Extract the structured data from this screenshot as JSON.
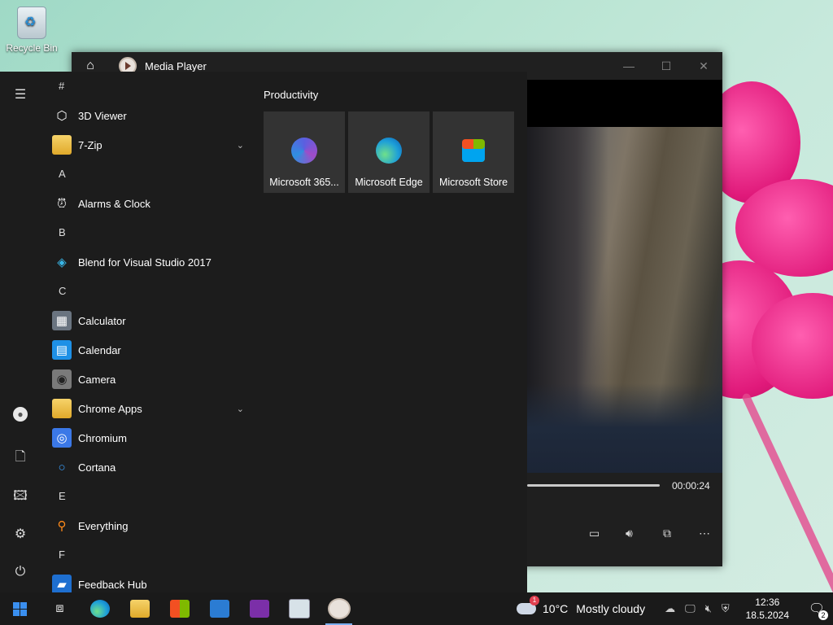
{
  "desktop": {
    "recycle_bin_label": "Recycle Bin"
  },
  "media_player": {
    "title": "Media Player",
    "time": "00:00:24",
    "progress": 1.0
  },
  "start": {
    "sections": [
      {
        "letter": "#",
        "items": [
          {
            "label": "3D Viewer",
            "icon": "cube-icon"
          },
          {
            "label": "7-Zip",
            "icon": "folder-icon",
            "expandable": true
          }
        ]
      },
      {
        "letter": "A",
        "items": [
          {
            "label": "Alarms & Clock",
            "icon": "clock-icon"
          }
        ]
      },
      {
        "letter": "B",
        "items": [
          {
            "label": "Blend for Visual Studio 2017",
            "icon": "blend-icon"
          }
        ]
      },
      {
        "letter": "C",
        "items": [
          {
            "label": "Calculator",
            "icon": "calculator-icon"
          },
          {
            "label": "Calendar",
            "icon": "calendar-icon"
          },
          {
            "label": "Camera",
            "icon": "camera-icon"
          },
          {
            "label": "Chrome Apps",
            "icon": "folder-icon",
            "expandable": true
          },
          {
            "label": "Chromium",
            "icon": "chromium-icon"
          },
          {
            "label": "Cortana",
            "icon": "cortana-icon"
          }
        ]
      },
      {
        "letter": "E",
        "items": [
          {
            "label": "Everything",
            "icon": "search-icon"
          }
        ]
      },
      {
        "letter": "F",
        "items": [
          {
            "label": "Feedback Hub",
            "icon": "feedback-icon"
          }
        ]
      }
    ],
    "group_title": "Productivity",
    "tiles": [
      {
        "label": "Microsoft 365...",
        "icon": "microsoft-365-icon"
      },
      {
        "label": "Microsoft Edge",
        "icon": "edge-icon"
      },
      {
        "label": "Microsoft Store",
        "icon": "store-icon"
      }
    ]
  },
  "taskbar": {
    "weather_temp": "10°C",
    "weather_text": "Mostly cloudy",
    "weather_badge": "1",
    "time": "12:36",
    "date": "18.5.2024",
    "notification_count": "2"
  },
  "colors": {
    "accent": "#7aaef0",
    "start_bg": "#1c1c1c",
    "tile_bg": "#333333"
  }
}
